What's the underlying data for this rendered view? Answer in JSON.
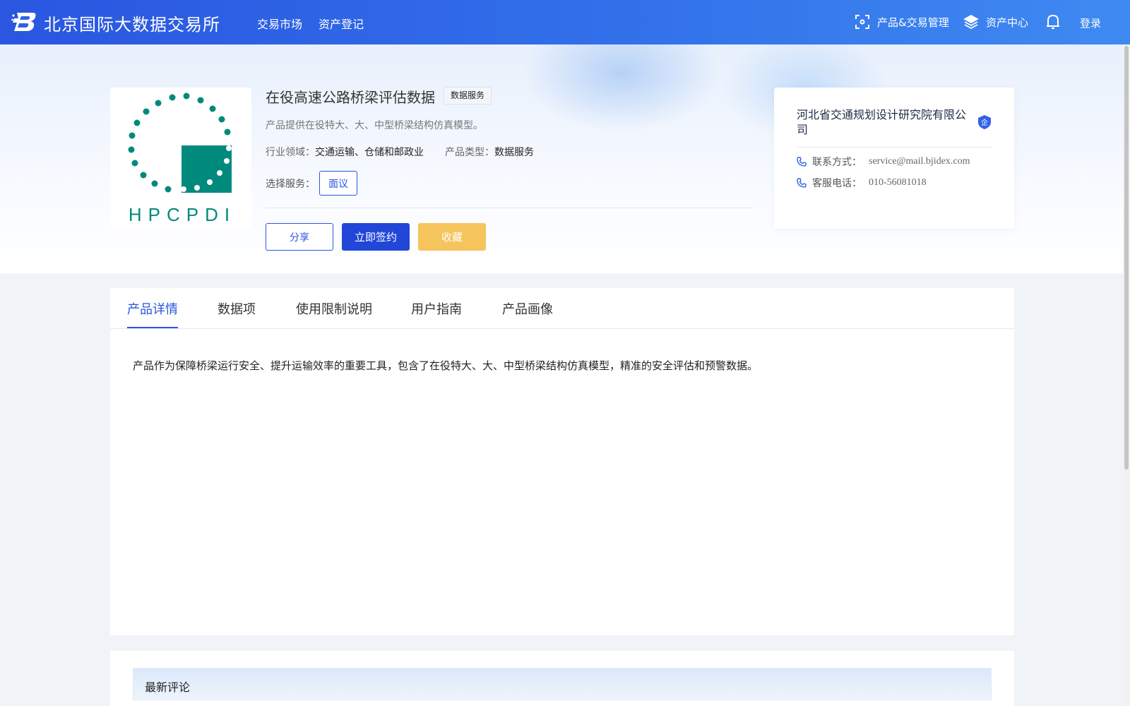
{
  "header": {
    "site_name": "北京国际大数据交易所",
    "nav": {
      "market": "交易市场",
      "asset_register": "资产登记"
    },
    "right": {
      "product_trade_mgmt": "产品&交易管理",
      "asset_center": "资产中心",
      "login": "登录"
    }
  },
  "product": {
    "logo_text": "HPCPDI",
    "title": "在役高速公路桥梁评估数据",
    "badge": "数据服务",
    "description": "产品提供在役特大、大、中型桥梁结构仿真模型。",
    "industry_label": "行业领域：",
    "industry_value": "交通运输、仓储和邮政业",
    "type_label": "产品类型：",
    "type_value": "数据服务",
    "service_label": "选择服务：",
    "service_option": "面议",
    "buttons": {
      "share": "分享",
      "sign": "立即签约",
      "favorite": "收藏"
    }
  },
  "company": {
    "name": "河北省交通规划设计研究院有限公司",
    "verify_badge": "企",
    "contact_label": "联系方式：",
    "contact_value": "service@mail.bjidex.com",
    "phone_label": "客服电话：",
    "phone_value": "010-56081018"
  },
  "tabs": {
    "detail": "产品详情",
    "data_items": "数据项",
    "usage_limits": "使用限制说明",
    "user_guide": "用户指南",
    "product_profile": "产品画像"
  },
  "detail_text": "产品作为保障桥梁运行安全、提升运输效率的重要工具，包含了在役特大、大、中型桥梁结构仿真模型，精准的安全评估和预警数据。",
  "comments": {
    "title": "最新评论"
  },
  "colors": {
    "primary": "#2a56e0",
    "favorite": "#f5c45d",
    "logo_teal": "#008a7e"
  }
}
